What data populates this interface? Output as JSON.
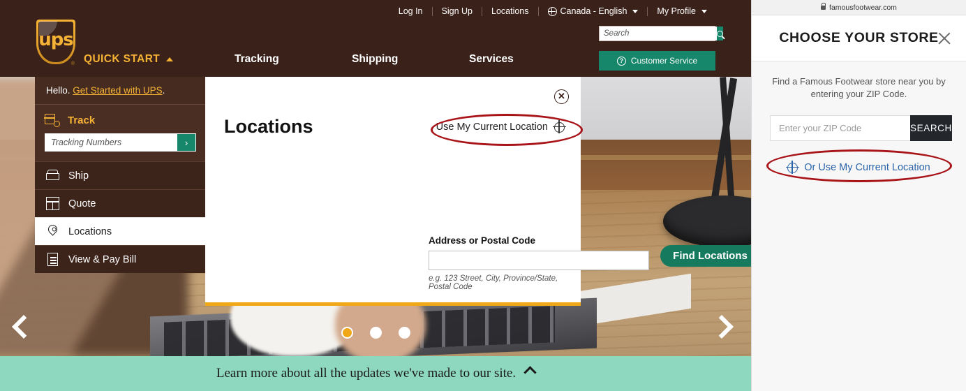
{
  "ups": {
    "brand": {
      "logo_text": "ups",
      "trademark": "®"
    },
    "quick_start": {
      "label": "QUICK START",
      "chevron": "chevron-up-icon"
    },
    "utility_nav": [
      {
        "label": "Log In"
      },
      {
        "label": "Sign Up"
      },
      {
        "label": "Locations"
      },
      {
        "label": "Canada - English",
        "icon": "globe-icon",
        "chevron": "chevron-down-icon"
      },
      {
        "label": "My Profile",
        "chevron": "chevron-down-icon"
      }
    ],
    "main_nav": [
      {
        "label": "Tracking"
      },
      {
        "label": "Shipping"
      },
      {
        "label": "Services"
      }
    ],
    "search": {
      "placeholder": "Search",
      "icon": "search-icon"
    },
    "customer_service": {
      "label": "Customer Service",
      "icon": "question-circle-icon"
    },
    "sidebar": {
      "greeting_prefix": "Hello.",
      "greeting_link": "Get Started with UPS",
      "greeting_suffix": ".",
      "track": {
        "label": "Track",
        "icon": "track-package-icon",
        "placeholder": "Tracking Numbers",
        "submit": "›"
      },
      "items": [
        {
          "label": "Ship",
          "icon": "ship-box-icon",
          "active": false
        },
        {
          "label": "Quote",
          "icon": "calculator-icon",
          "active": false
        },
        {
          "label": "Locations",
          "icon": "map-pin-icon",
          "active": true
        },
        {
          "label": "View & Pay Bill",
          "icon": "document-icon",
          "active": false
        }
      ]
    },
    "modal": {
      "title": "Locations",
      "close_icon": "close-circle-icon",
      "use_current_location": {
        "label": "Use My Current Location",
        "icon": "crosshair-icon"
      },
      "field_label": "Address or Postal Code",
      "field_value": "",
      "field_placeholder": "",
      "hint": "e.g. 123 Street, City, Province/State, Postal Code",
      "find_button": "Find Locations"
    },
    "carousel": {
      "prev_icon": "chevron-left-icon",
      "next_icon": "chevron-right-icon",
      "dots": 3,
      "active_dot": 1
    },
    "banner": {
      "text": "Learn more about all the updates we've made to our site.",
      "chevron": "chevron-up-icon"
    }
  },
  "famous_footwear": {
    "url": "famousfootwear.com",
    "url_icon": "lock-icon",
    "title": "CHOOSE YOUR STORE",
    "close_icon": "close-icon",
    "description": "Find a Famous Footwear store near you by entering your ZIP Code.",
    "zip": {
      "placeholder": "Enter your ZIP Code",
      "value": ""
    },
    "search_button": "SEARCH",
    "use_current_location": {
      "label": "Or Use My Current Location",
      "icon": "crosshair-icon"
    }
  },
  "annotations": {
    "highlight_color": "#a81418",
    "shape": "ellipse",
    "count": 2
  },
  "colors": {
    "ups_brown": "#3a211a",
    "ups_gold": "#f0a819",
    "ups_green": "#16876a",
    "banner_mint": "#8fd8c0",
    "ff_dark": "#23272c",
    "ff_link_blue": "#2b63a8"
  }
}
